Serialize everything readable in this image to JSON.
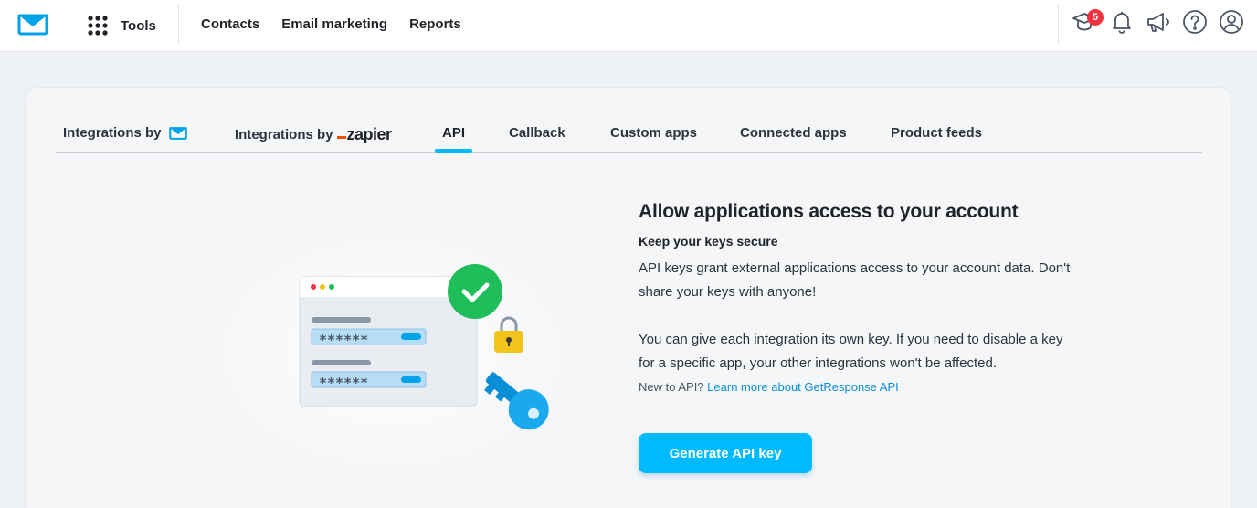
{
  "topbar": {
    "tools_label": "Tools",
    "nav": [
      "Contacts",
      "Email marketing",
      "Reports"
    ],
    "notification_count": "5",
    "icons": [
      "courses-icon",
      "bell-icon",
      "megaphone-icon",
      "help-icon",
      "account-icon"
    ]
  },
  "tabs": {
    "items": [
      {
        "label": "Integrations by"
      },
      {
        "label": "Integrations by",
        "brand": "zapier"
      },
      {
        "label": "API"
      },
      {
        "label": "Callback"
      },
      {
        "label": "Custom apps"
      },
      {
        "label": "Connected apps"
      },
      {
        "label": "Product feeds"
      }
    ],
    "active": "API"
  },
  "illustration": {
    "masked_key": "******"
  },
  "content": {
    "heading": "Allow applications access to your account",
    "subheading": "Keep your keys secure",
    "para1": "API keys grant external applications access to your account data. Don't share your keys with anyone!",
    "para2": "You can give each integration its own key. If you need to disable a key for a specific app, your other integrations won't be affected.",
    "new_to_api": "New to API?",
    "learn_more": "Learn more about GetResponse API",
    "button_label": "Generate API key"
  },
  "colors": {
    "accent": "#00baff",
    "badge": "#ef3340",
    "check": "#1fbe5a",
    "lock": "#f2c318",
    "link": "#0a8fd6"
  }
}
